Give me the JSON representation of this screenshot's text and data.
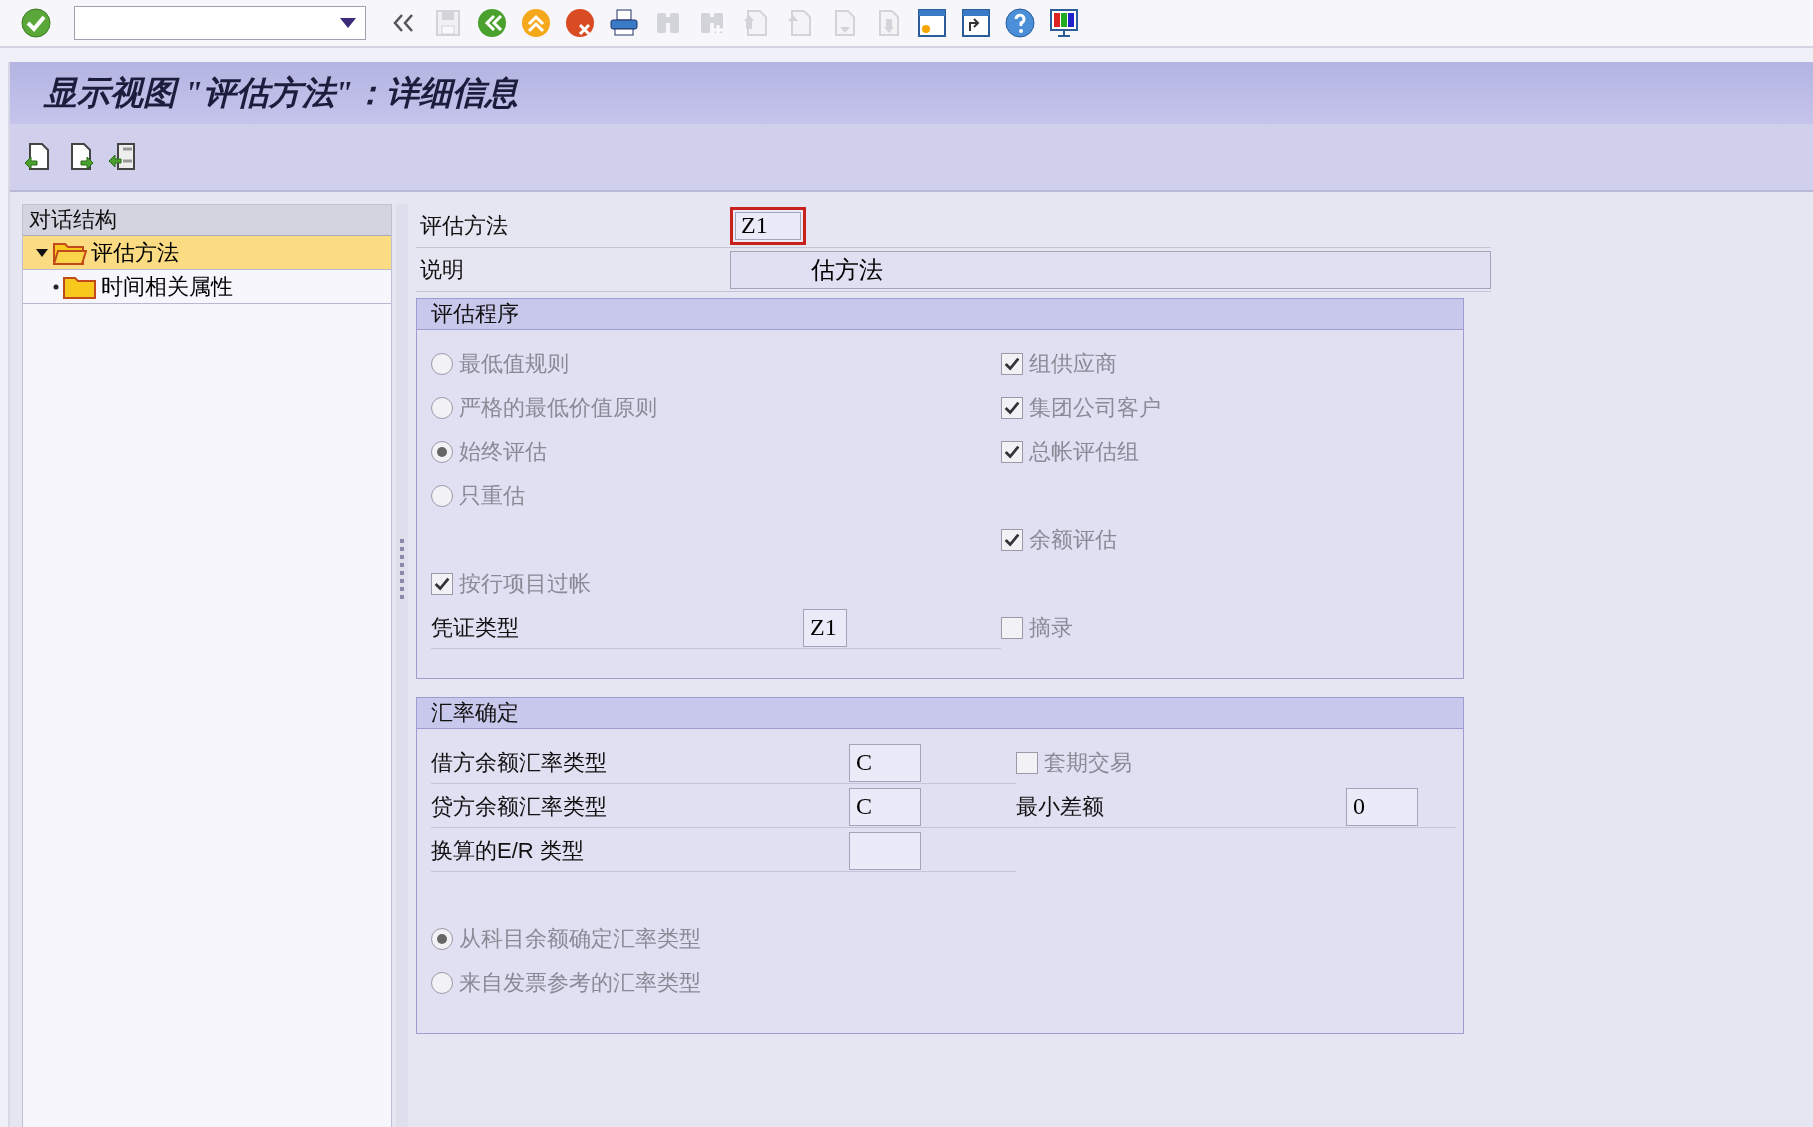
{
  "toolbar": [
    {
      "kind": "enter",
      "disabled": false
    },
    {
      "kind": "command-field",
      "disabled": false
    },
    {
      "kind": "collapse",
      "disabled": false
    },
    {
      "kind": "save",
      "disabled": true
    },
    {
      "kind": "back",
      "disabled": false
    },
    {
      "kind": "exit",
      "disabled": false
    },
    {
      "kind": "cancel",
      "disabled": false
    },
    {
      "kind": "print",
      "disabled": false
    },
    {
      "kind": "find",
      "disabled": true
    },
    {
      "kind": "find-next",
      "disabled": true
    },
    {
      "kind": "first-page",
      "disabled": true
    },
    {
      "kind": "previous-page",
      "disabled": true
    },
    {
      "kind": "next-page",
      "disabled": true
    },
    {
      "kind": "last-page",
      "disabled": true
    },
    {
      "kind": "new-session",
      "disabled": false
    },
    {
      "kind": "shortcut",
      "disabled": false
    },
    {
      "kind": "help",
      "disabled": false
    },
    {
      "kind": "layout",
      "disabled": false
    }
  ],
  "title": "显示视图 \"评估方法\"：详细信息",
  "app_toolbar": [
    {
      "kind": "previous-entry"
    },
    {
      "kind": "next-entry"
    },
    {
      "kind": "other-entry"
    }
  ],
  "dialog_structure": {
    "header": "对话结构",
    "items": [
      {
        "label": "评估方法",
        "selected": true,
        "expanded": true,
        "children": [
          {
            "label": "时间相关属性",
            "selected": false
          }
        ]
      }
    ]
  },
  "fields": [
    {
      "label": "评估方法",
      "value": "Z1",
      "focused": true
    },
    {
      "label": "说明",
      "value": "估方法",
      "focused": false
    }
  ],
  "groups": [
    {
      "title": "评估程序",
      "rows": [
        {
          "left": {
            "kind": "radio",
            "label": "最低值规则",
            "selected": false
          },
          "right": {
            "kind": "checkbox",
            "label": "组供应商",
            "checked": true
          }
        },
        {
          "left": {
            "kind": "radio",
            "label": "严格的最低价值原则",
            "selected": false
          },
          "right": {
            "kind": "checkbox",
            "label": "集团公司客户",
            "checked": true
          }
        },
        {
          "left": {
            "kind": "radio",
            "label": "始终评估",
            "selected": true
          },
          "right": {
            "kind": "checkbox",
            "label": "总帐评估组",
            "checked": true
          }
        },
        {
          "left": {
            "kind": "radio",
            "label": "只重估",
            "selected": false
          }
        },
        {
          "right": {
            "kind": "checkbox",
            "label": "余额评估",
            "checked": true
          }
        },
        {
          "left": {
            "kind": "checkbox",
            "label": "按行项目过帐",
            "checked": true
          }
        },
        {
          "left": {
            "kind": "field",
            "label": "凭证类型",
            "value": "Z1"
          },
          "right": {
            "kind": "checkbox",
            "label": "摘录",
            "checked": false
          }
        }
      ]
    },
    {
      "title": "汇率确定",
      "rows": [
        {
          "left": {
            "kind": "field",
            "label": "借方余额汇率类型",
            "value": "C"
          },
          "right": {
            "kind": "checkbox",
            "label": "套期交易",
            "checked": false
          }
        },
        {
          "left": {
            "kind": "field",
            "label": "贷方余额汇率类型",
            "value": "C"
          },
          "right": {
            "kind": "field",
            "label": "最小差额",
            "value": "0"
          }
        },
        {
          "left": {
            "kind": "field",
            "label": "换算的E/R 类型"
          }
        },
        {},
        {
          "left": {
            "kind": "radio",
            "label": "从科目余额确定汇率类型",
            "selected": true
          }
        },
        {
          "left": {
            "kind": "radio",
            "label": "来自发票参考的汇率类型",
            "selected": false
          }
        }
      ]
    }
  ]
}
